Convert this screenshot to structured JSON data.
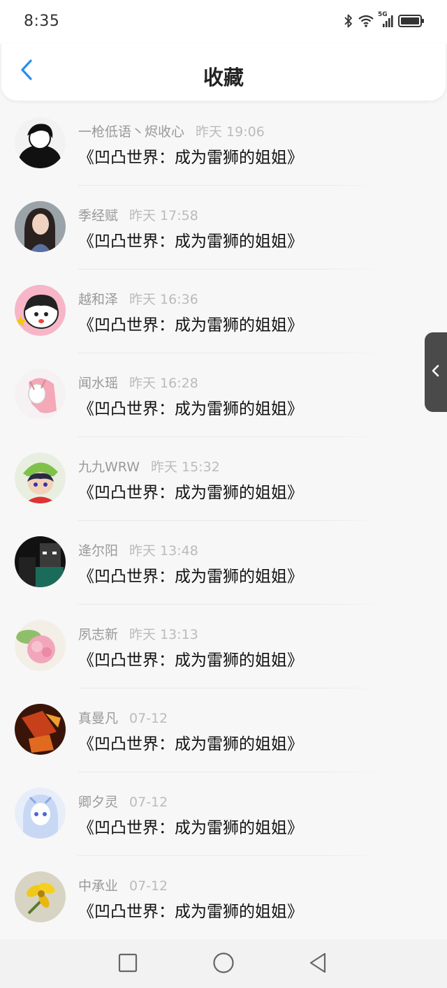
{
  "status_bar": {
    "time": "8:35",
    "icons": [
      "bluetooth-icon",
      "wifi-icon",
      "signal-5g-icon",
      "battery-icon"
    ],
    "network_label": "5G"
  },
  "header": {
    "title": "收藏",
    "back_icon": "chevron-left-icon",
    "accent_color": "#2a8df0"
  },
  "items": [
    {
      "user": "一枪低语丶烬收心",
      "time": "昨天 19:06",
      "title": "《凹凸世界：成为雷狮的姐姐》"
    },
    {
      "user": "季经赋",
      "time": "昨天 17:58",
      "title": "《凹凸世界：成为雷狮的姐姐》"
    },
    {
      "user": "越和泽",
      "time": "昨天 16:36",
      "title": "《凹凸世界：成为雷狮的姐姐》"
    },
    {
      "user": "闻水瑶",
      "time": "昨天 16:28",
      "title": "《凹凸世界：成为雷狮的姐姐》"
    },
    {
      "user": "九九WRW",
      "time": "昨天 15:32",
      "title": "《凹凸世界：成为雷狮的姐姐》"
    },
    {
      "user": "逄尔阳",
      "time": "昨天 13:48",
      "title": "《凹凸世界：成为雷狮的姐姐》"
    },
    {
      "user": "夙志新",
      "time": "昨天 13:13",
      "title": "《凹凸世界：成为雷狮的姐姐》"
    },
    {
      "user": "真曼凡",
      "time": "07-12",
      "title": "《凹凸世界：成为雷狮的姐姐》"
    },
    {
      "user": "卿夕灵",
      "time": "07-12",
      "title": "《凹凸世界：成为雷狮的姐姐》"
    },
    {
      "user": "中承业",
      "time": "07-12",
      "title": "《凹凸世界：成为雷狮的姐姐》"
    }
  ],
  "side_tab": {
    "icon": "chevron-left-icon"
  },
  "nav_bar": {
    "icons": [
      "square-recents-icon",
      "circle-home-icon",
      "triangle-back-icon"
    ]
  }
}
